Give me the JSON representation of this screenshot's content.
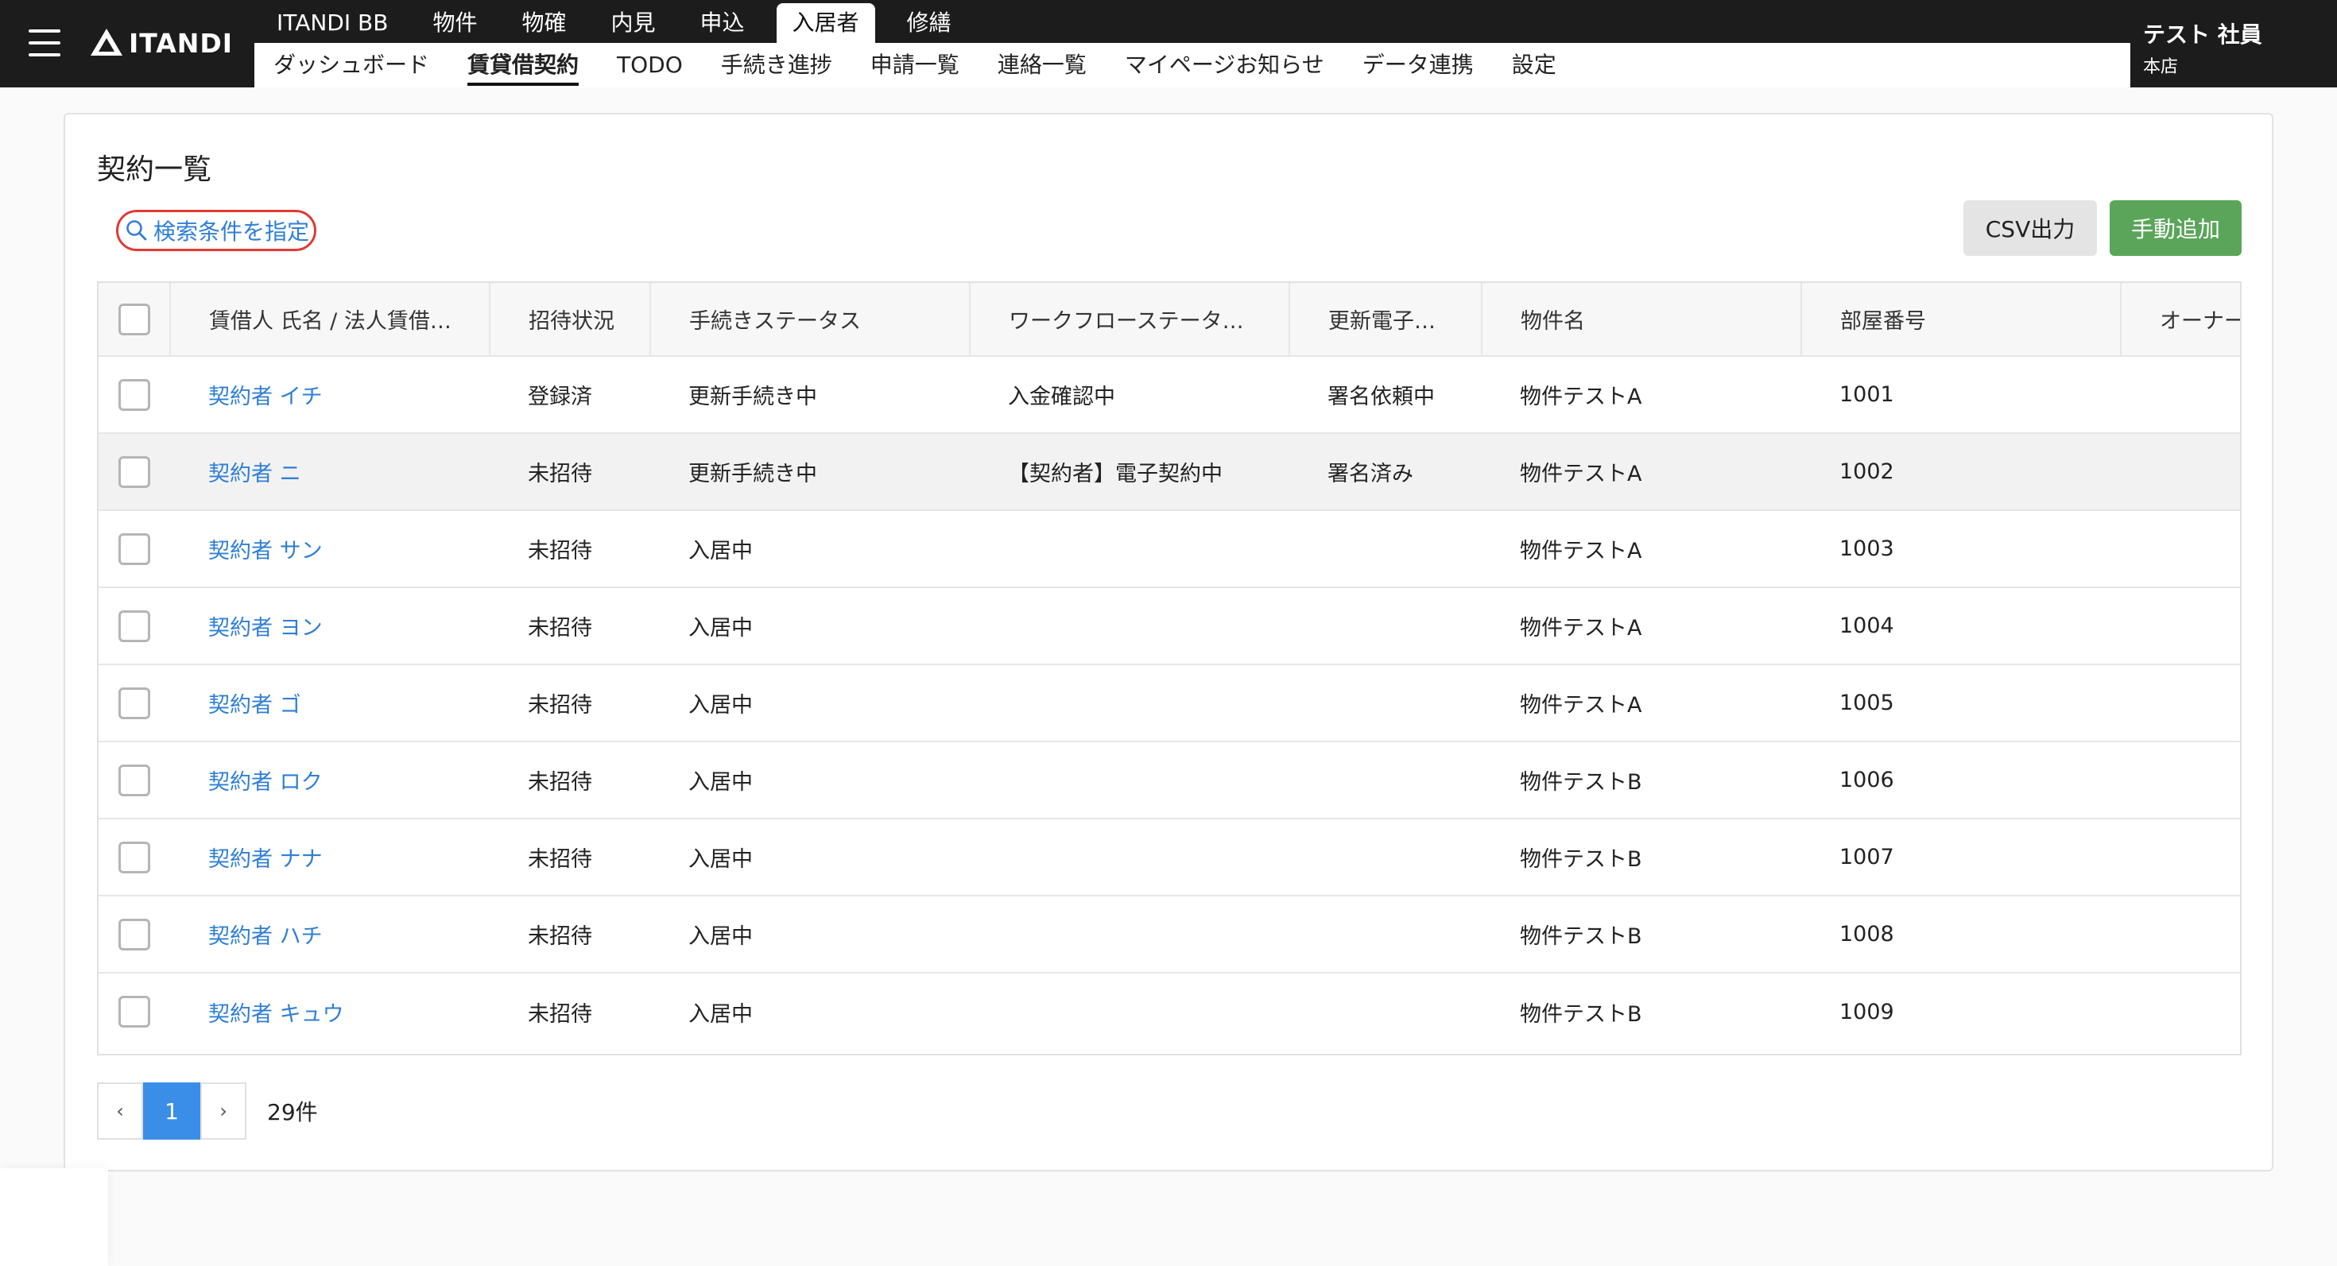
{
  "brand": {
    "logo_text": "ITANDI"
  },
  "topnav": [
    {
      "label": "ITANDI BB"
    },
    {
      "label": "物件"
    },
    {
      "label": "物確"
    },
    {
      "label": "内見"
    },
    {
      "label": "申込"
    },
    {
      "label": "入居者",
      "active": true
    },
    {
      "label": "修繕"
    }
  ],
  "subnav": [
    {
      "label": "ダッシュボード"
    },
    {
      "label": "賃貸借契約",
      "active": true
    },
    {
      "label": "TODO"
    },
    {
      "label": "手続き進捗"
    },
    {
      "label": "申請一覧"
    },
    {
      "label": "連絡一覧"
    },
    {
      "label": "マイページお知らせ"
    },
    {
      "label": "データ連携"
    },
    {
      "label": "設定"
    }
  ],
  "user": {
    "name": "テスト 社員",
    "branch": "本店"
  },
  "page": {
    "title": "契約一覧",
    "search_label": "検索条件を指定",
    "csv_label": "CSV出力",
    "add_label": "手動追加"
  },
  "table": {
    "columns": [
      "賃借人 氏名 / 法人賃借…",
      "招待状況",
      "手続きステータス",
      "ワークフローステータ…",
      "更新電子…",
      "物件名",
      "部屋番号",
      "オーナー"
    ],
    "rows": [
      {
        "name": "契約者 イチ",
        "invite": "登録済",
        "procedure": "更新手続き中",
        "workflow": "入金確認中",
        "esign": "署名依頼中",
        "property": "物件テストA",
        "room": "1001",
        "owner": ""
      },
      {
        "name": "契約者 ニ",
        "invite": "未招待",
        "procedure": "更新手続き中",
        "workflow": "【契約者】電子契約中",
        "esign": "署名済み",
        "property": "物件テストA",
        "room": "1002",
        "owner": ""
      },
      {
        "name": "契約者 サン",
        "invite": "未招待",
        "procedure": "入居中",
        "workflow": "",
        "esign": "",
        "property": "物件テストA",
        "room": "1003",
        "owner": ""
      },
      {
        "name": "契約者 ヨン",
        "invite": "未招待",
        "procedure": "入居中",
        "workflow": "",
        "esign": "",
        "property": "物件テストA",
        "room": "1004",
        "owner": ""
      },
      {
        "name": "契約者 ゴ",
        "invite": "未招待",
        "procedure": "入居中",
        "workflow": "",
        "esign": "",
        "property": "物件テストA",
        "room": "1005",
        "owner": ""
      },
      {
        "name": "契約者 ロク",
        "invite": "未招待",
        "procedure": "入居中",
        "workflow": "",
        "esign": "",
        "property": "物件テストB",
        "room": "1006",
        "owner": ""
      },
      {
        "name": "契約者 ナナ",
        "invite": "未招待",
        "procedure": "入居中",
        "workflow": "",
        "esign": "",
        "property": "物件テストB",
        "room": "1007",
        "owner": ""
      },
      {
        "name": "契約者 ハチ",
        "invite": "未招待",
        "procedure": "入居中",
        "workflow": "",
        "esign": "",
        "property": "物件テストB",
        "room": "1008",
        "owner": ""
      },
      {
        "name": "契約者 キュウ",
        "invite": "未招待",
        "procedure": "入居中",
        "workflow": "",
        "esign": "",
        "property": "物件テストB",
        "room": "1009",
        "owner": ""
      }
    ]
  },
  "pagination": {
    "prev": "‹",
    "current": "1",
    "next": "›",
    "total": "29件"
  },
  "colors": {
    "header_bg": "#1c1c1c",
    "link": "#2f7fd6",
    "add_button": "#5aa55a",
    "pager_active": "#3b8ee8",
    "highlight_ring": "#e03a32"
  }
}
